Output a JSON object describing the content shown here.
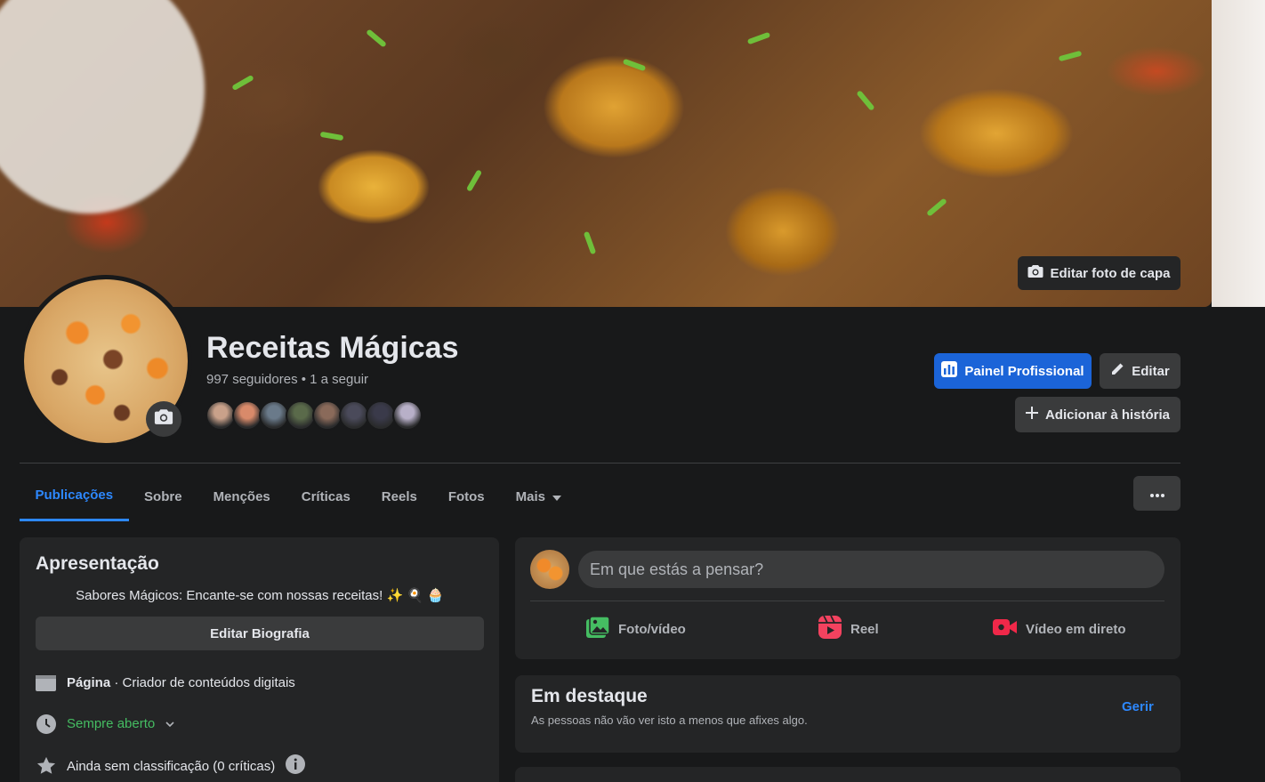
{
  "cover": {
    "edit_label": "Editar foto de capa",
    "icon": "camera-icon"
  },
  "profile": {
    "name": "Receitas Mágicas",
    "stats": "997 seguidores • 1 a seguir",
    "follower_face_colors": [
      "#c9a18a",
      "#d98a6a",
      "#6a7a8a",
      "#5a6a4a",
      "#8a6a5a",
      "#4a4a5a",
      "#3a3a4a",
      "#b8b0c8"
    ]
  },
  "actions": {
    "pro_dashboard": "Painel Profissional",
    "edit": "Editar",
    "add_story": "Adicionar à história"
  },
  "tabs": [
    {
      "label": "Publicações",
      "active": true
    },
    {
      "label": "Sobre"
    },
    {
      "label": "Menções"
    },
    {
      "label": "Críticas"
    },
    {
      "label": "Reels"
    },
    {
      "label": "Fotos"
    },
    {
      "label": "Mais"
    }
  ],
  "intro": {
    "title": "Apresentação",
    "bio": "Sabores Mágicos: Encante-se com nossas receitas! ✨ 🍳 🧁",
    "edit_bio": "Editar Biografia",
    "page_label": "Página",
    "page_category": " · Criador de conteúdos digitais",
    "hours": "Sempre aberto",
    "rating": "Ainda sem classificação (0 críticas)"
  },
  "composer": {
    "placeholder": "Em que estás a pensar?",
    "photo_video": "Foto/vídeo",
    "reel": "Reel",
    "live": "Vídeo em direto"
  },
  "featured": {
    "title": "Em destaque",
    "subtitle": "As pessoas não vão ver isto a menos que afixes algo.",
    "manage": "Gerir"
  },
  "colors": {
    "accent": "#2d88ff",
    "primary_button": "#1b64d8",
    "background": "#18191a",
    "card": "#242526"
  }
}
